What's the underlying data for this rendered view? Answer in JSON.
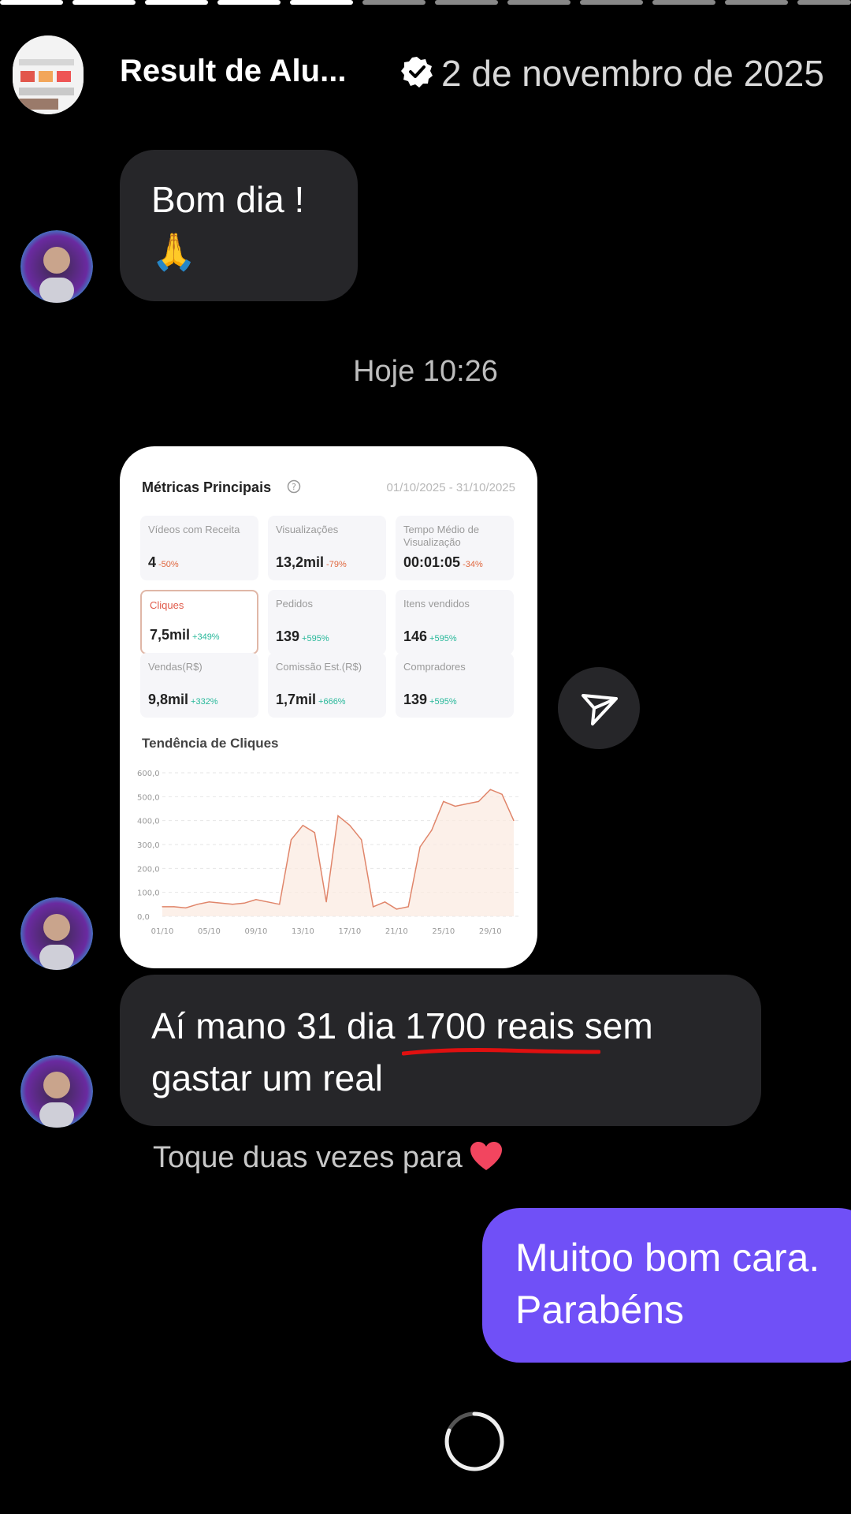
{
  "header": {
    "title": "Result de Alu...",
    "date": "2 de novembro de 2025"
  },
  "messages": {
    "greeting_line": "Bom dia !",
    "greeting_emoji": "🙏",
    "timestamp": "Hoje 10:26",
    "caption_prefix": "Aí mano 31 dia ",
    "caption_highlight": "1700 reais",
    "caption_suffix": " sem",
    "caption_line2": "gastar um real",
    "double_tap_hint": "Toque duas vezes para",
    "sent_line1": "Muitoo bom cara.",
    "sent_line2": "Parabéns"
  },
  "dashboard": {
    "title": "Métricas Principais",
    "date_range": "01/10/2025 - 31/10/2025",
    "metrics": [
      {
        "label": "Vídeos com Receita",
        "value": "4",
        "change": "-50%"
      },
      {
        "label": "Visualizações",
        "value": "13,2mil",
        "change": "-79%"
      },
      {
        "label": "Tempo Médio de Visualização",
        "value": "00:01:05",
        "change": "-34%"
      },
      {
        "label": "Cliques",
        "value": "7,5mil",
        "change": "+349%"
      },
      {
        "label": "Pedidos",
        "value": "139",
        "change": "+595%"
      },
      {
        "label": "Itens vendidos",
        "value": "146",
        "change": "+595%"
      },
      {
        "label": "Vendas(R$)",
        "value": "9,8mil",
        "change": "+332%"
      },
      {
        "label": "Comissão Est.(R$)",
        "value": "1,7mil",
        "change": "+666%"
      },
      {
        "label": "Compradores",
        "value": "139",
        "change": "+595%"
      }
    ],
    "trend_title": "Tendência de Cliques"
  },
  "chart_data": {
    "type": "area",
    "title": "Tendência de Cliques",
    "y_ticks": [
      "600,0",
      "500,0",
      "400,0",
      "300,0",
      "200,0",
      "100,0",
      "0,0"
    ],
    "x_ticks": [
      "01/10",
      "05/10",
      "09/10",
      "13/10",
      "17/10",
      "21/10",
      "25/10",
      "29/10"
    ],
    "ylim": [
      0,
      600
    ],
    "grid": true,
    "series": [
      {
        "x": [
          "01/10",
          "02/10",
          "03/10",
          "04/10",
          "05/10",
          "06/10",
          "07/10",
          "08/10",
          "09/10",
          "10/10",
          "11/10",
          "12/10",
          "13/10",
          "14/10",
          "15/10",
          "16/10",
          "17/10",
          "18/10",
          "19/10",
          "20/10",
          "21/10",
          "22/10",
          "23/10",
          "24/10",
          "25/10",
          "26/10",
          "27/10",
          "28/10",
          "29/10",
          "30/10",
          "31/10"
        ],
        "values": [
          40,
          40,
          35,
          50,
          60,
          55,
          50,
          55,
          70,
          60,
          50,
          320,
          380,
          350,
          60,
          420,
          380,
          320,
          40,
          60,
          30,
          40,
          290,
          360,
          480,
          460,
          470,
          480,
          530,
          510,
          400
        ]
      }
    ],
    "accent_color": "#e0856a"
  },
  "colors": {
    "background": "#000000",
    "received_bubble": "#262629",
    "sent_bubble": "#7050f7",
    "highlight_underline": "#e01010"
  }
}
